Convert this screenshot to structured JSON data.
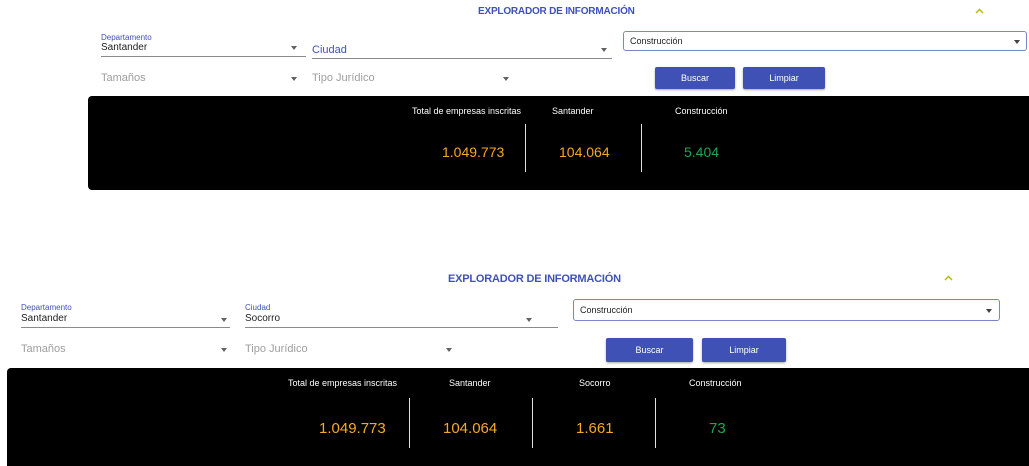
{
  "colors": {
    "primary": "#3f51b5",
    "value_yellow": "#f9a825",
    "value_green": "#1aa84f",
    "panel_bg": "#000000",
    "chevron": "#b8b800"
  },
  "top": {
    "title": "EXPLORADOR DE INFORMACIÓN",
    "collapse_icon": "chevron-up-icon",
    "departamento": {
      "label": "Departamento",
      "value": "Santander"
    },
    "ciudad": {
      "placeholder": "Ciudad"
    },
    "actividad": {
      "value": "Construcción"
    },
    "tamanos": {
      "placeholder": "Tamaños"
    },
    "tipo_juridico": {
      "placeholder": "Tipo Jurídico"
    },
    "buscar": "Buscar",
    "limpiar": "Limpiar",
    "stats": [
      {
        "label": "Total de empresas inscritas",
        "value": "1.049.773",
        "color": "yellow"
      },
      {
        "label": "Santander",
        "value": "104.064",
        "color": "yellow"
      },
      {
        "label": "Construcción",
        "value": "5.404",
        "color": "green"
      }
    ]
  },
  "bottom": {
    "title": "EXPLORADOR DE INFORMACIÓN",
    "collapse_icon": "chevron-up-icon",
    "departamento": {
      "label": "Departamento",
      "value": "Santander"
    },
    "ciudad": {
      "label": "Ciudad",
      "value": "Socorro"
    },
    "actividad": {
      "value": "Construcción"
    },
    "tamanos": {
      "placeholder": "Tamaños"
    },
    "tipo_juridico": {
      "placeholder": "Tipo Jurídico"
    },
    "buscar": "Buscar",
    "limpiar": "Limpiar",
    "stats": [
      {
        "label": "Total de empresas inscritas",
        "value": "1.049.773",
        "color": "yellow"
      },
      {
        "label": "Santander",
        "value": "104.064",
        "color": "yellow"
      },
      {
        "label": "Socorro",
        "value": "1.661",
        "color": "yellow"
      },
      {
        "label": "Construcción",
        "value": "73",
        "color": "green"
      }
    ]
  }
}
